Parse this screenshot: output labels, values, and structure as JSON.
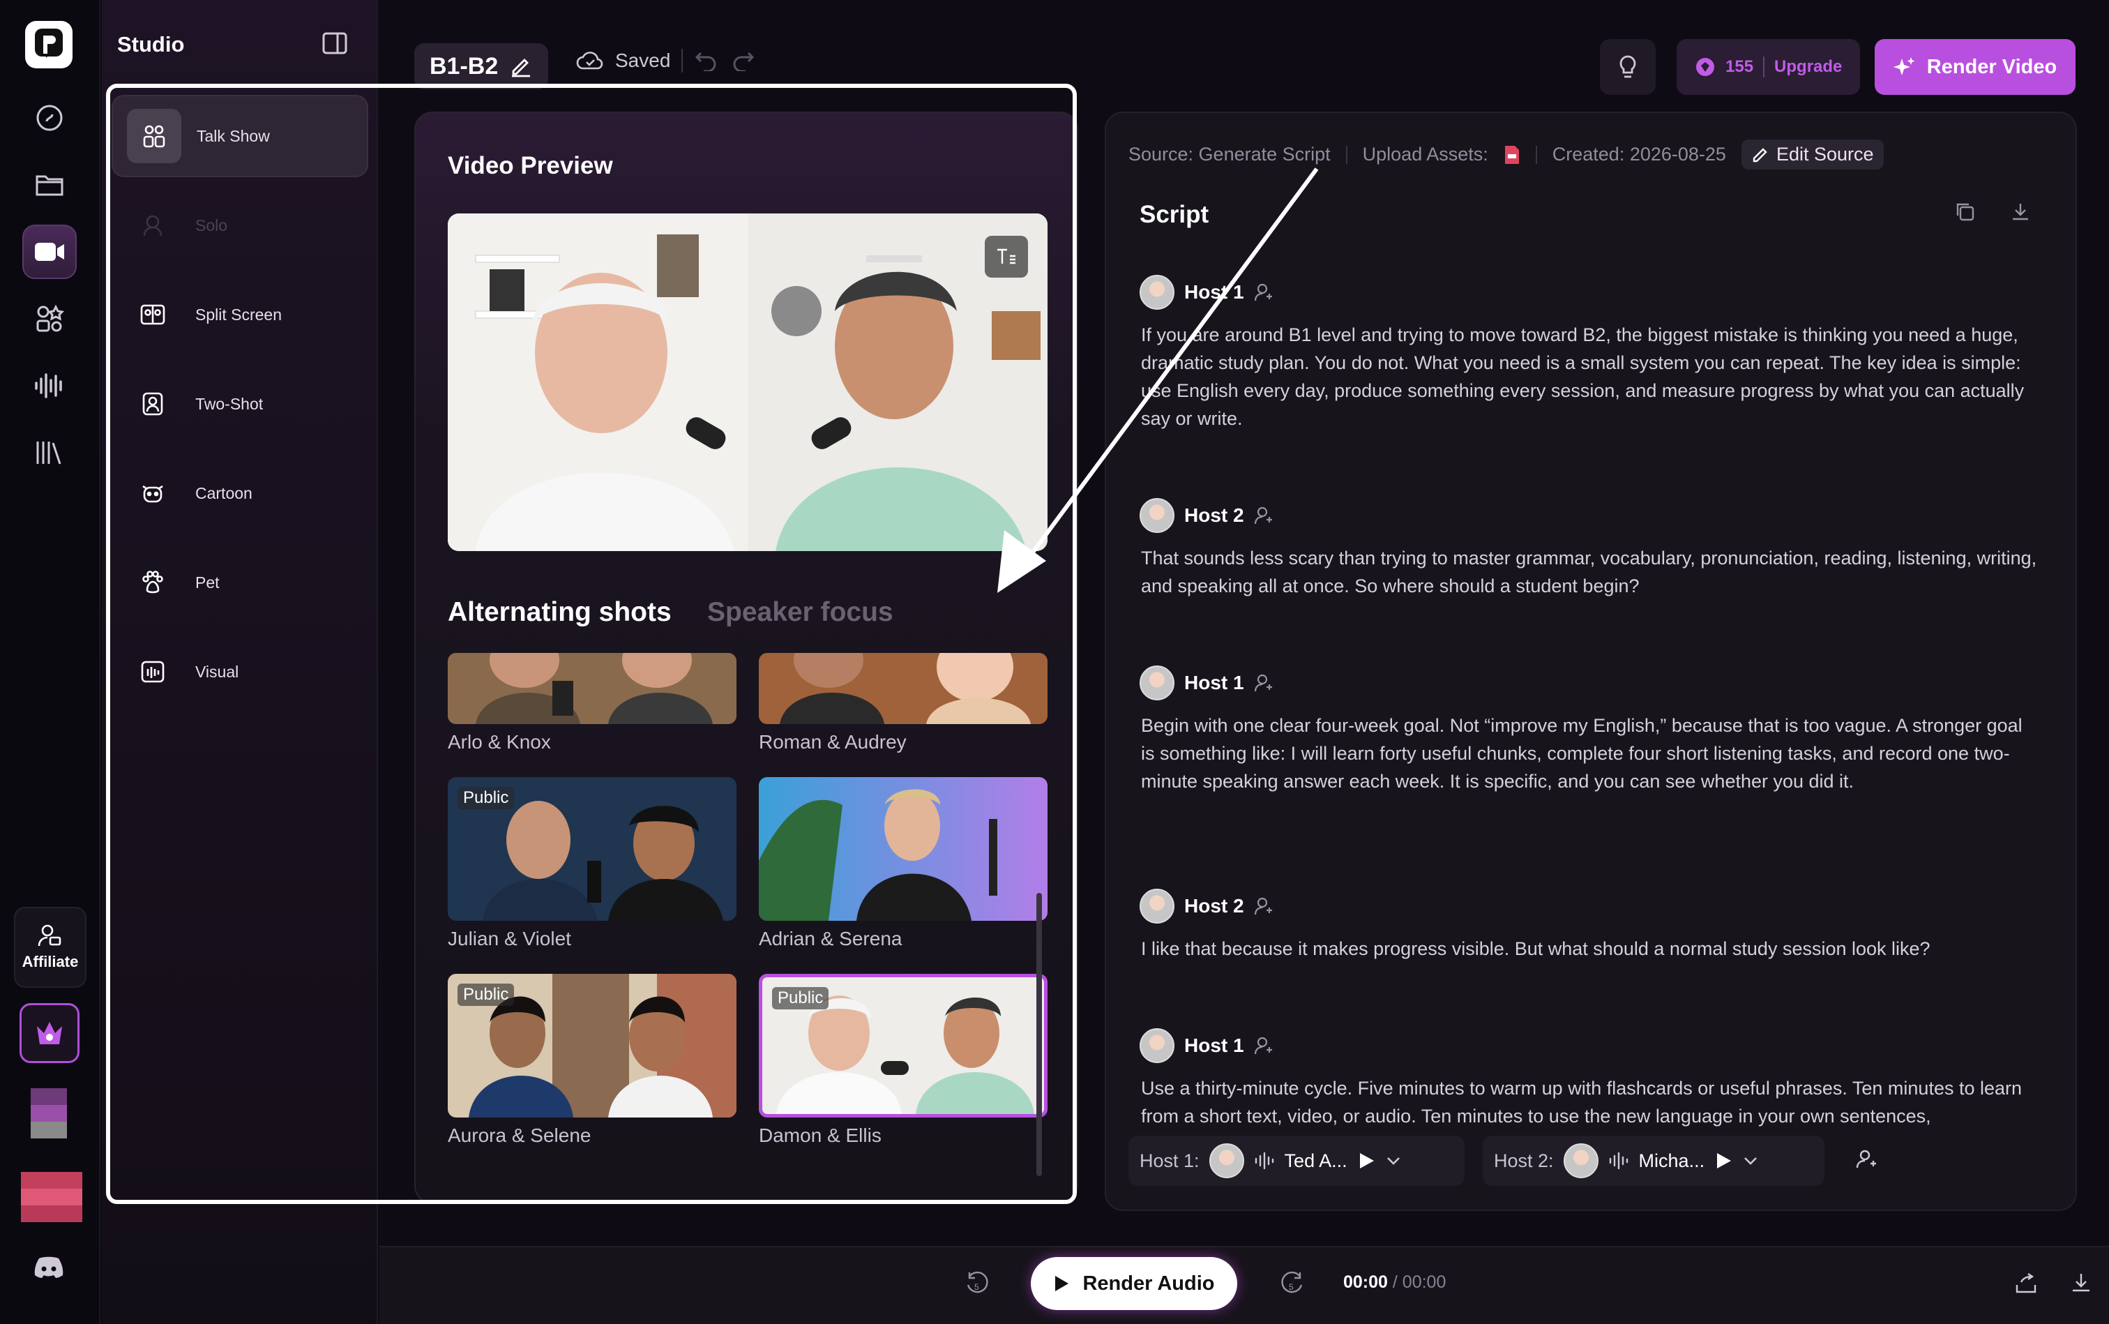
{
  "studio": {
    "title": "Studio"
  },
  "categories": [
    {
      "label": "Talk Show",
      "icon": "talk-show-icon"
    },
    {
      "label": "Solo",
      "icon": "solo-icon"
    },
    {
      "label": "Split Screen",
      "icon": "split-screen-icon"
    },
    {
      "label": "Two-Shot",
      "icon": "two-shot-icon"
    },
    {
      "label": "Cartoon",
      "icon": "cartoon-icon"
    },
    {
      "label": "Pet",
      "icon": "paw-icon"
    },
    {
      "label": "Visual",
      "icon": "visual-icon"
    }
  ],
  "rail": {
    "affiliate_label": "Affiliate"
  },
  "toolbar": {
    "project_name": "B1-B2",
    "saved_label": "Saved",
    "credits": "155",
    "upgrade_label": "Upgrade",
    "render_video_label": "Render Video"
  },
  "preview": {
    "title": "Video Preview",
    "tab_active": "Alternating shots",
    "tab_inactive": "Speaker focus",
    "thumbnails": [
      {
        "name": "Arlo & Knox",
        "public": ""
      },
      {
        "name": "Roman & Audrey",
        "public": ""
      },
      {
        "name": "Julian & Violet",
        "public": "Public"
      },
      {
        "name": "Adrian & Serena",
        "public": ""
      },
      {
        "name": "Aurora & Selene",
        "public": "Public"
      },
      {
        "name": "Damon & Ellis",
        "public": "Public"
      }
    ]
  },
  "script": {
    "source_label": "Source: Generate Script",
    "upload_label": "Upload Assets:",
    "created_label": "Created: 2026-08-25",
    "edit_source_label": "Edit Source",
    "title": "Script",
    "entries": [
      {
        "speaker": "Host 1",
        "text": "If you are around B1 level and trying to move toward B2, the biggest mistake is thinking you need a huge, dramatic study plan. You do not. What you need is a small system you can repeat. The key idea is simple: use English every day, produce something every session, and measure progress by what you can actually say or write."
      },
      {
        "speaker": "Host 2",
        "text": "That sounds less scary than trying to master grammar, vocabulary, pronunciation, reading, listening, writing, and speaking all at once. So where should a student begin?"
      },
      {
        "speaker": "Host 1",
        "text": "Begin with one clear four-week goal. Not “improve my English,” because that is too vague. A stronger goal is something like: I will learn forty useful chunks, complete four short listening tasks, and record one two-minute speaking answer each week. It is specific, and you can see whether you did it."
      },
      {
        "speaker": "Host 2",
        "text": "I like that because it makes progress visible. But what should a normal study session look like?"
      },
      {
        "speaker": "Host 1",
        "text": "Use a thirty-minute cycle. Five minutes to warm up with flashcards or useful phrases. Ten minutes to learn from a short text, video, or audio. Ten minutes to use the new language in your own sentences,"
      }
    ],
    "host1_label": "Host 1:",
    "host1_voice": "Ted A...",
    "host2_label": "Host 2:",
    "host2_voice": "Micha..."
  },
  "bottom": {
    "render_audio_label": "Render Audio",
    "time_current": "00:00",
    "time_total": "/ 00:00"
  },
  "colors": {
    "accent": "#b94fdf",
    "bg": "#0e0b14",
    "panel": "#17141b"
  }
}
